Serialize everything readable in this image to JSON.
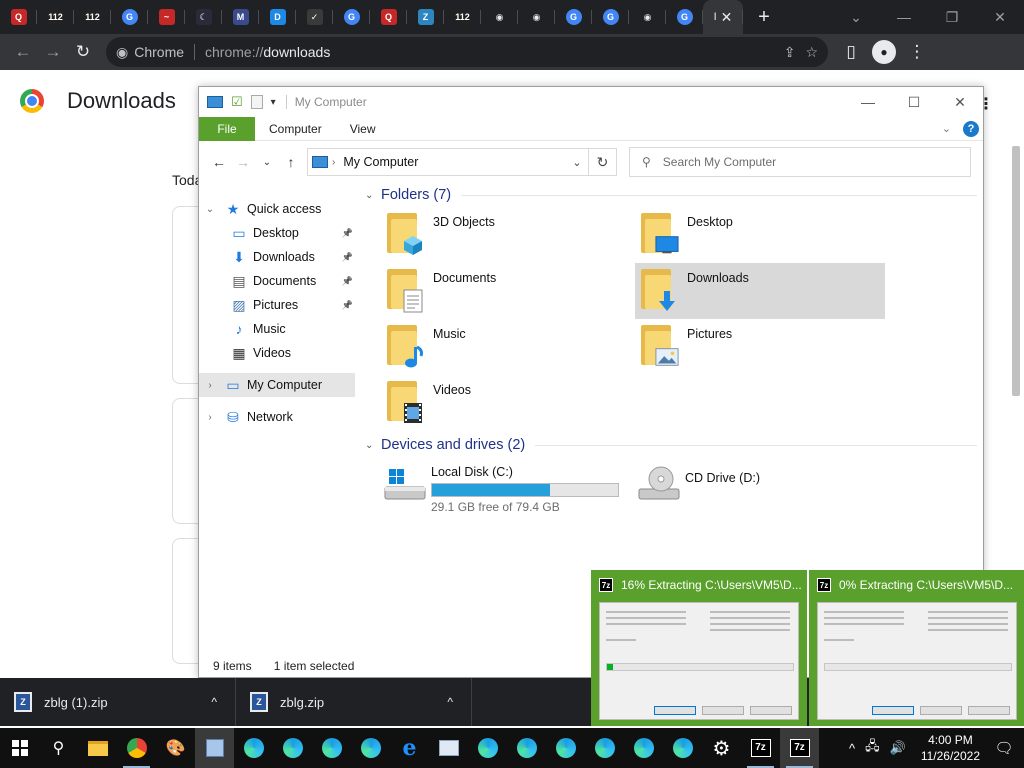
{
  "browser": {
    "tabs": [
      {
        "icon": "q-icon",
        "glyph": "Q",
        "color": "#c62828"
      },
      {
        "icon": "n112-icon",
        "glyph": "112",
        "color": "#222"
      },
      {
        "icon": "n112-icon",
        "glyph": "112",
        "color": "#222"
      },
      {
        "icon": "google-icon",
        "glyph": "G",
        "color": "#ffffff"
      },
      {
        "icon": "swoosh-icon",
        "glyph": "~",
        "color": "#c62828"
      },
      {
        "icon": "moon-icon",
        "glyph": "☾",
        "color": "#2a2a3a"
      },
      {
        "icon": "chart-icon",
        "glyph": "M",
        "color": "#3b4a8c"
      },
      {
        "icon": "d-icon",
        "glyph": "D",
        "color": "#1e88e5"
      },
      {
        "icon": "check-icon",
        "glyph": "✓",
        "color": "#3a3a3a"
      },
      {
        "icon": "mail-icon",
        "glyph": "G",
        "color": "#e0e0e0"
      },
      {
        "icon": "q-icon",
        "glyph": "Q",
        "color": "#c62828"
      },
      {
        "icon": "note-icon",
        "glyph": "Z",
        "color": "#2e86c1"
      },
      {
        "icon": "n112-icon",
        "glyph": "112",
        "color": "#222"
      },
      {
        "icon": "github-icon",
        "glyph": "◉",
        "color": "#ffffff"
      },
      {
        "icon": "github-icon",
        "glyph": "◉",
        "color": "#ffffff"
      },
      {
        "icon": "google-icon",
        "glyph": "G",
        "color": "#ffffff"
      },
      {
        "icon": "google-icon",
        "glyph": "G",
        "color": "#ffffff"
      },
      {
        "icon": "github-icon",
        "glyph": "◉",
        "color": "#ffffff"
      },
      {
        "icon": "google-icon",
        "glyph": "G",
        "color": "#ffffff"
      }
    ],
    "active_tab_label": "I",
    "omnibox": {
      "chip": "Chrome",
      "url_scheme": "chrome://",
      "url_path": "downloads"
    }
  },
  "downloads_page": {
    "title": "Downloads",
    "section": "Toda"
  },
  "explorer": {
    "title": "My Computer",
    "ribbon_tabs": [
      "File",
      "Computer",
      "View"
    ],
    "address": "My Computer",
    "search_placeholder": "Search My Computer",
    "nav": [
      {
        "label": "Quick access",
        "icon": "star-icon",
        "chev": "⌄",
        "indent": 0
      },
      {
        "label": "Desktop",
        "icon": "desktop-icon",
        "pin": true,
        "indent": 1
      },
      {
        "label": "Downloads",
        "icon": "download-arrow-icon",
        "pin": true,
        "indent": 1
      },
      {
        "label": "Documents",
        "icon": "document-icon",
        "pin": true,
        "indent": 1
      },
      {
        "label": "Pictures",
        "icon": "pictures-icon",
        "pin": true,
        "indent": 1
      },
      {
        "label": "Music",
        "icon": "music-icon",
        "indent": 1
      },
      {
        "label": "Videos",
        "icon": "video-icon",
        "indent": 1
      },
      {
        "label": "My Computer",
        "icon": "computer-icon",
        "chev": "›",
        "indent": 0,
        "selected": true
      },
      {
        "label": "Network",
        "icon": "network-icon",
        "chev": "›",
        "indent": 0
      }
    ],
    "folders_header": "Folders (7)",
    "folders": [
      {
        "label": "3D Objects",
        "badge": "3d-cube-icon"
      },
      {
        "label": "Desktop",
        "badge": "desktop-icon"
      },
      {
        "label": "Documents",
        "badge": "document-icon"
      },
      {
        "label": "Downloads",
        "badge": "download-arrow-icon",
        "selected": true
      },
      {
        "label": "Music",
        "badge": "music-icon"
      },
      {
        "label": "Pictures",
        "badge": "pictures-icon"
      },
      {
        "label": "Videos",
        "badge": "video-icon"
      }
    ],
    "drives_header": "Devices and drives (2)",
    "drives": [
      {
        "label": "Local Disk (C:)",
        "free": "29.1 GB free of 79.4 GB",
        "used_fraction": 0.633,
        "icon": "local-disk-icon"
      },
      {
        "label": "CD Drive (D:)",
        "icon": "cd-drive-icon"
      }
    ],
    "status": {
      "items": "9 items",
      "selected": "1 item selected"
    }
  },
  "shelf": [
    {
      "name": "zblg (1).zip"
    },
    {
      "name": "zblg.zip"
    }
  ],
  "thumbnails": [
    {
      "title": "16% Extracting C:\\Users\\VM5\\D...",
      "progress": 0.03
    },
    {
      "title": "0% Extracting C:\\Users\\VM5\\D...",
      "progress": 0.0
    }
  ],
  "taskbar": {
    "time": "4:00 PM",
    "date": "11/26/2022"
  },
  "colors": {
    "ribbon_file": "#5aa02c",
    "drive_bar": "#26a0da",
    "selected_folder": "#d9d9d9",
    "thumb_bg": "#5aa02c"
  }
}
